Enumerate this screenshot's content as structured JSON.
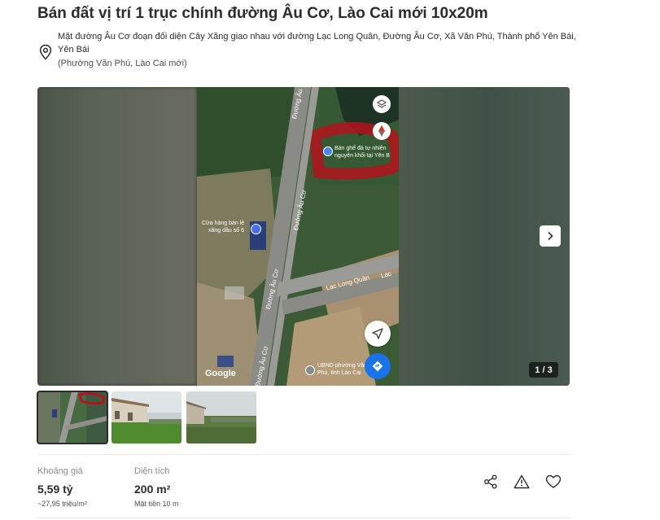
{
  "listing": {
    "title": "Bán đất vị trí 1 trục chính đường Âu Cơ, Lào Cai mới 10x20m",
    "address_line": "Mặt đường Âu Cơ đoạn đối diện Cây Xăng giao nhau với đường Lạc Long Quân, Đường Âu Cơ, Xã Văn Phú, Thành phố Yên Bái, Yên Bái",
    "address_new": "(Phường Văn Phú, Lào Cai mới)"
  },
  "gallery": {
    "counter": "1 / 3",
    "map_labels": {
      "road_au_co_top": "Đường Âu Cơ",
      "road_au_co_mid": "Đường Âu Cơ",
      "road_au_co_low": "Đường Âu Cơ",
      "road_au_co_bottom": "Đường Âu Cơ",
      "road_lac_long_quan": "Lạc Long Quân",
      "road_lac_right": "Lạc",
      "poi_shop_line1": "Bán ghế đá tự nhiên",
      "poi_shop_line2": "nguyên khối tại Yên B",
      "poi_fuel_line1": "Cửa hàng bán lẻ",
      "poi_fuel_line2": "xăng dầu số 6",
      "poi_ward_line1": "UBND phường Văn",
      "poi_ward_line2": "Phú, tỉnh Lào Cai",
      "google_logo": "Google"
    },
    "thumbnails": [
      "map-thumbnail",
      "building-thumbnail",
      "field-thumbnail"
    ]
  },
  "details": {
    "price_label": "Khoảng giá",
    "price_value": "5,59 tỷ",
    "price_sub": "~27,95 triệu/m²",
    "area_label": "Diện tích",
    "area_value": "200 m²",
    "area_sub": "Mặt tiền 10 m"
  },
  "actions": [
    "share-icon",
    "report-icon",
    "heart-icon"
  ],
  "colors": {
    "text": "#2c2c2c",
    "muted": "#8c8c8c",
    "map_blue": "#1a73e8",
    "highlight_red": "#b3141c"
  }
}
